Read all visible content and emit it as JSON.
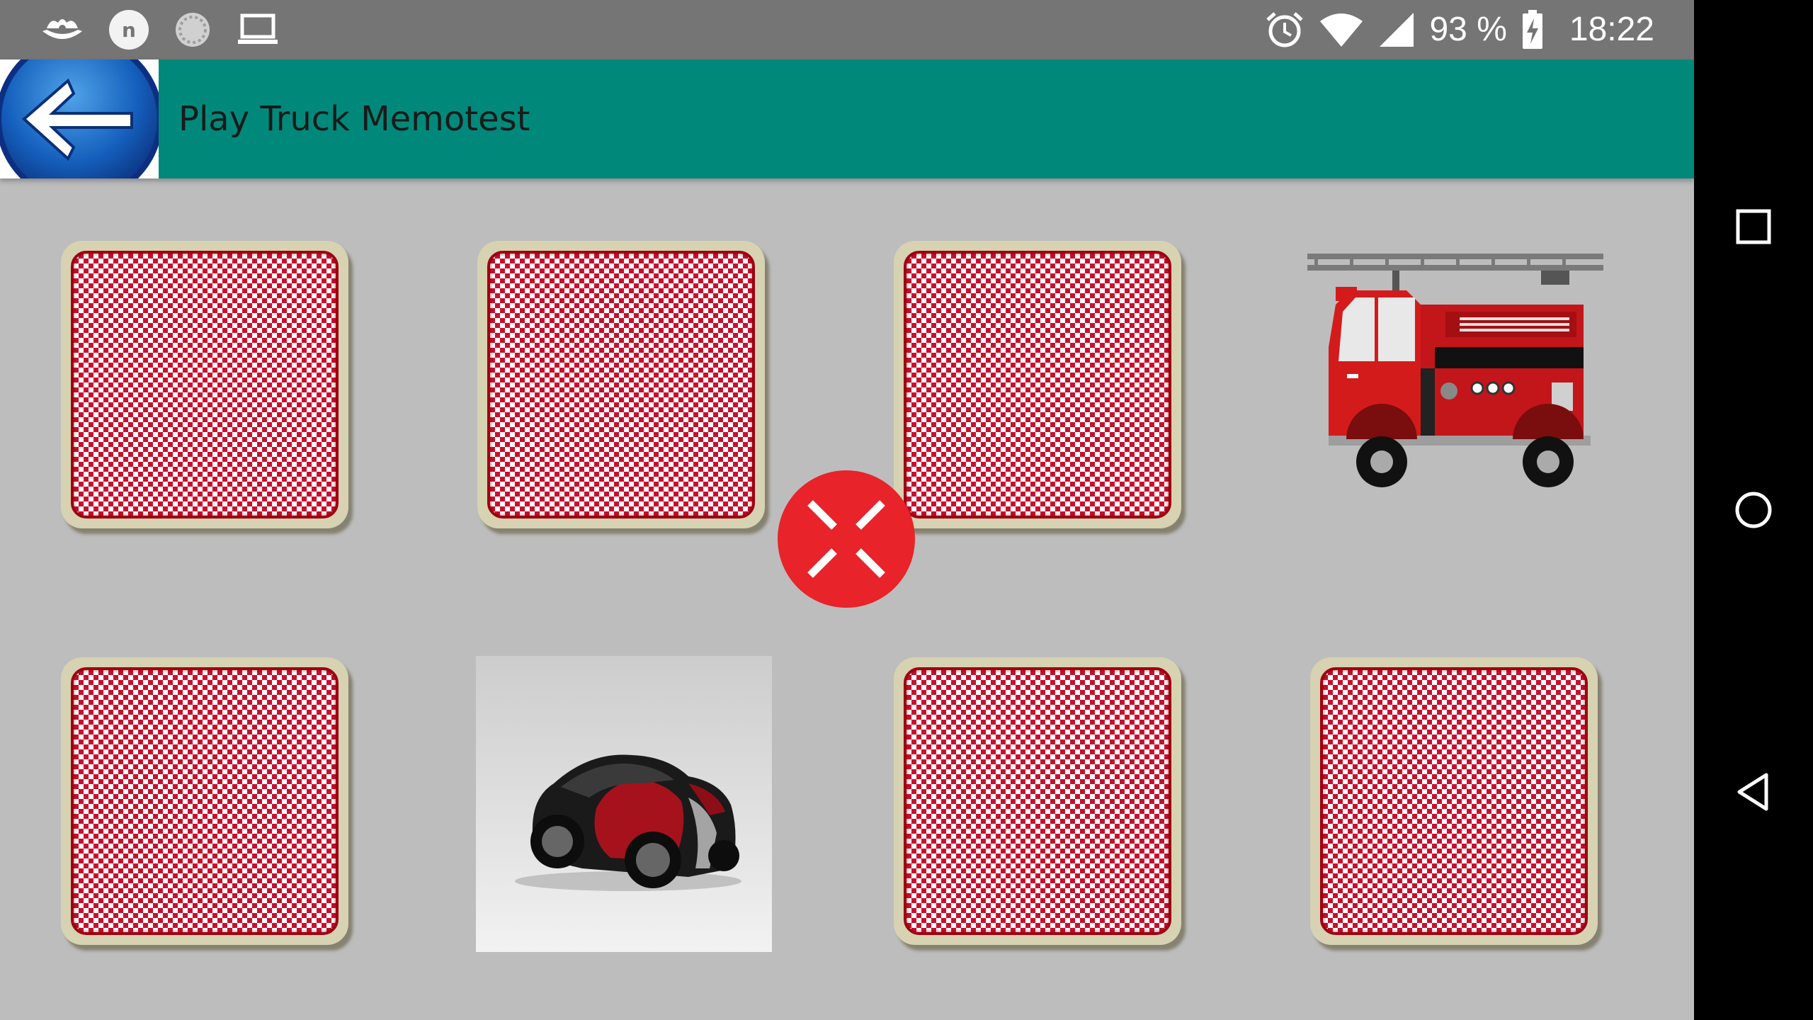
{
  "status_bar": {
    "icons_left": [
      "boat-notification-icon",
      "n-notification-icon",
      "loading-circle-icon",
      "laptop-icon"
    ],
    "notif_letter": "n",
    "icons_right": [
      "alarm-icon",
      "wifi-icon",
      "cell-signal-icon",
      "battery-charging-icon"
    ],
    "battery": "93 %",
    "time": "18:22"
  },
  "app_bar": {
    "back_icon": "back-arrow-icon",
    "title": "Play Truck Memotest",
    "color": "#00897b"
  },
  "game": {
    "cards": [
      {
        "row": 1,
        "col": 1,
        "state": "face-down"
      },
      {
        "row": 1,
        "col": 2,
        "state": "face-down"
      },
      {
        "row": 1,
        "col": 3,
        "state": "face-down"
      },
      {
        "row": 1,
        "col": 4,
        "state": "face-up",
        "picture": "fire-truck"
      },
      {
        "row": 2,
        "col": 1,
        "state": "face-down"
      },
      {
        "row": 2,
        "col": 2,
        "state": "face-up",
        "picture": "sports-car"
      },
      {
        "row": 2,
        "col": 3,
        "state": "face-down"
      },
      {
        "row": 2,
        "col": 4,
        "state": "face-down"
      }
    ],
    "card_back_color": "#c8102e",
    "exit_button_icon": "fullscreen-exit-icon",
    "exit_button_color": "#e8232a"
  },
  "nav_bar": {
    "recents_icon": "square-recents-icon",
    "home_icon": "circle-home-icon",
    "back_icon": "triangle-back-icon"
  }
}
